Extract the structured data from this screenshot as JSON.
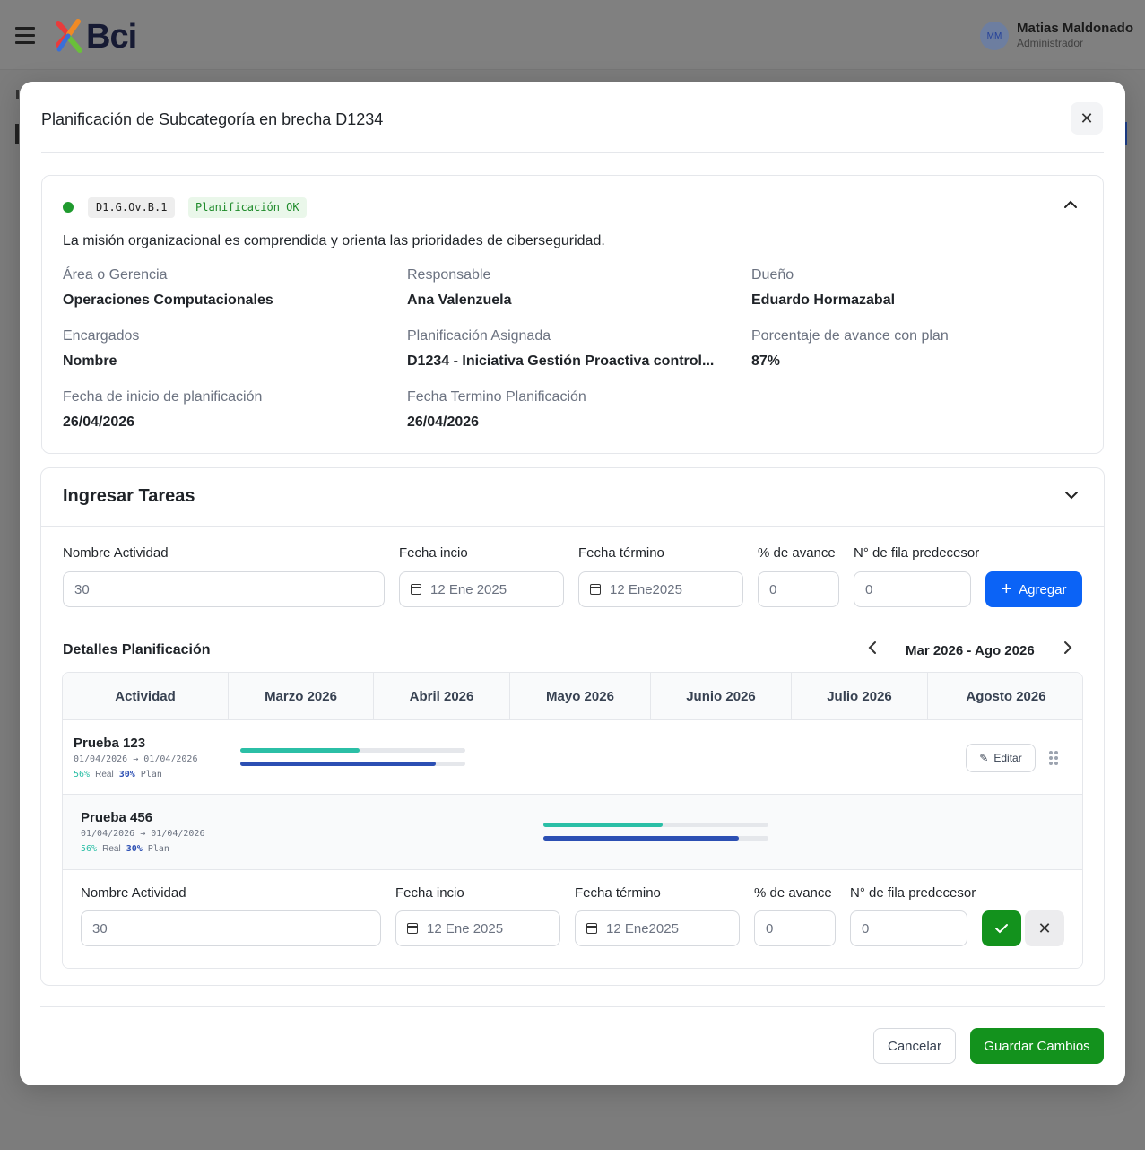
{
  "header": {
    "logo_text": "Bci",
    "user": {
      "initials": "MM",
      "name": "Matias Maldonado",
      "role": "Administrador"
    }
  },
  "modal": {
    "title": "Planificación de Subcategoría en brecha D1234",
    "close_icon": "close-icon",
    "subcategory": {
      "code": "D1.G.Ov.B.1",
      "status": "Planificación OK",
      "status_color": "#1e8b2a",
      "dot_color": "#1f9a2e",
      "description": "La misión organizacional es comprendida y orienta las prioridades de ciberseguridad.",
      "fields": [
        {
          "label": "Área o Gerencia",
          "value": "Operaciones Computacionales"
        },
        {
          "label": "Responsable",
          "value": "Ana Valenzuela"
        },
        {
          "label": "Dueño",
          "value": "Eduardo Hormazabal"
        },
        {
          "label": "Encargados",
          "value": "Nombre"
        },
        {
          "label": "Planificación Asignada",
          "value": "D1234 - Iniciativa Gestión Proactiva control..."
        },
        {
          "label": "Porcentaje de avance con plan",
          "value": "87%"
        },
        {
          "label": "Fecha de inicio de planificación",
          "value": "26/04/2026"
        },
        {
          "label": "Fecha Termino Planificación",
          "value": "26/04/2026"
        }
      ]
    },
    "tasks": {
      "title": "Ingresar Tareas",
      "form": {
        "name_label": "Nombre Actividad",
        "name_value": "30",
        "start_label": "Fecha incio",
        "start_value": "12 Ene 2025",
        "end_label": "Fecha término",
        "end_value": "12 Ene2025",
        "progress_label": "% de avance",
        "progress_value": "0",
        "pred_label": "N° de  fila predecesor",
        "pred_value": "0",
        "add_label": "Agregar"
      },
      "details_title": "Detalles Planificación",
      "range_label": "Mar 2026 - Ago 2026",
      "columns": [
        "Actividad",
        "Marzo 2026",
        "Abril 2026",
        "Mayo 2026",
        "Junio 2026",
        "Julio 2026",
        "Agosto 2026"
      ],
      "rows": [
        {
          "name": "Prueba 123",
          "dates": "01/04/2026 → 01/04/2026",
          "real_pct": "56%",
          "real_label": "Real",
          "plan_pct": "30%",
          "plan_label": "Plan",
          "real_fraction": 0.53,
          "plan_fraction": 0.87,
          "edit_label": "Editar"
        },
        {
          "name": "Prueba 456",
          "dates": "01/04/2026 → 01/04/2026",
          "real_pct": "56%",
          "real_label": "Real",
          "plan_pct": "30%",
          "plan_label": "Plan",
          "real_fraction": 0.53,
          "plan_fraction": 0.87
        }
      ],
      "bar_colors": {
        "real": "#2bbfa6",
        "plan": "#2c4fb3"
      },
      "inline_form": {
        "name_label": "Nombre Actividad",
        "name_value": "30",
        "start_label": "Fecha incio",
        "start_value": "12 Ene 2025",
        "end_label": "Fecha término",
        "end_value": "12 Ene2025",
        "progress_label": "% de avance",
        "progress_value": "0",
        "pred_label": "N° de  fila predecesor",
        "pred_value": "0"
      }
    },
    "footer": {
      "cancel_label": "Cancelar",
      "save_label": "Guardar Cambios"
    }
  }
}
